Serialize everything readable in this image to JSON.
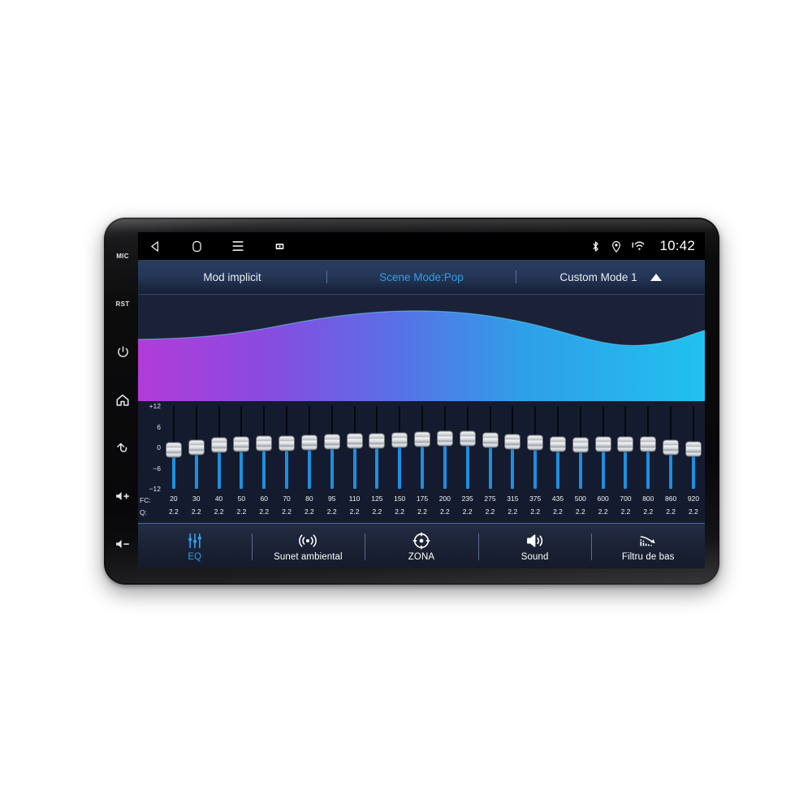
{
  "device": {
    "hard_keys": [
      {
        "name": "mic",
        "label": "MIC",
        "type": "text"
      },
      {
        "name": "reset",
        "label": "RST",
        "type": "text"
      },
      {
        "name": "power",
        "label": "",
        "type": "icon"
      },
      {
        "name": "home",
        "label": "",
        "type": "icon"
      },
      {
        "name": "back",
        "label": "",
        "type": "icon"
      },
      {
        "name": "volume-up",
        "label": "",
        "type": "icon"
      },
      {
        "name": "volume-down",
        "label": "",
        "type": "icon"
      }
    ]
  },
  "statusbar": {
    "nav_buttons": [
      "back-icon",
      "home-icon",
      "menu-icon",
      "screenshot-icon"
    ],
    "system_icons": [
      "bluetooth-icon",
      "location-icon",
      "wifi-icon"
    ],
    "clock": "10:42"
  },
  "modebar": {
    "items": [
      {
        "label": "Mod implicit",
        "active": false
      },
      {
        "label": "Scene Mode:Pop",
        "active": true
      },
      {
        "label": "Custom Mode 1",
        "active": false,
        "caret": true
      }
    ],
    "active_color": "#2f9fe8"
  },
  "curve": {
    "gradient_start": "#b23cd8",
    "gradient_end": "#21c1f0",
    "background": "#1b2237"
  },
  "equalizer": {
    "axis_labels": [
      "+12",
      "6",
      "0",
      "-6",
      "-12"
    ],
    "axis_values": [
      12,
      6,
      0,
      -6,
      -12
    ],
    "row_labels": {
      "fc": "FC:",
      "q": "Q:"
    },
    "track_color": "#1d8fe0",
    "bands": [
      {
        "fc": "20",
        "q": "2.2",
        "gain": -0.6
      },
      {
        "fc": "30",
        "q": "2.2",
        "gain": 0.0
      },
      {
        "fc": "40",
        "q": "2.2",
        "gain": 0.8
      },
      {
        "fc": "50",
        "q": "2.2",
        "gain": 1.0
      },
      {
        "fc": "60",
        "q": "2.2",
        "gain": 1.2
      },
      {
        "fc": "70",
        "q": "2.2",
        "gain": 1.2
      },
      {
        "fc": "80",
        "q": "2.2",
        "gain": 1.4
      },
      {
        "fc": "95",
        "q": "2.2",
        "gain": 1.6
      },
      {
        "fc": "110",
        "q": "2.2",
        "gain": 1.9
      },
      {
        "fc": "125",
        "q": "2.2",
        "gain": 2.0
      },
      {
        "fc": "150",
        "q": "2.2",
        "gain": 2.2
      },
      {
        "fc": "175",
        "q": "2.2",
        "gain": 2.3
      },
      {
        "fc": "200",
        "q": "2.2",
        "gain": 2.6
      },
      {
        "fc": "235",
        "q": "2.2",
        "gain": 2.6
      },
      {
        "fc": "275",
        "q": "2.2",
        "gain": 2.2
      },
      {
        "fc": "315",
        "q": "2.2",
        "gain": 1.6
      },
      {
        "fc": "375",
        "q": "2.2",
        "gain": 1.4
      },
      {
        "fc": "435",
        "q": "2.2",
        "gain": 1.0
      },
      {
        "fc": "500",
        "q": "2.2",
        "gain": 0.8
      },
      {
        "fc": "600",
        "q": "2.2",
        "gain": 0.9
      },
      {
        "fc": "700",
        "q": "2.2",
        "gain": 1.0
      },
      {
        "fc": "800",
        "q": "2.2",
        "gain": 0.9
      },
      {
        "fc": "860",
        "q": "2.2",
        "gain": 0.0
      },
      {
        "fc": "920",
        "q": "2.2",
        "gain": -0.5
      }
    ]
  },
  "tabbar": {
    "tabs": [
      {
        "label": "EQ",
        "icon": "equalizer-icon",
        "active": true
      },
      {
        "label": "Sunet ambiental",
        "icon": "surround-icon",
        "active": false
      },
      {
        "label": "ZONA",
        "icon": "zone-target-icon",
        "active": false
      },
      {
        "label": "Sound",
        "icon": "speaker-icon",
        "active": false
      },
      {
        "label": "Filtru de bas",
        "icon": "bass-filter-icon",
        "active": false
      }
    ]
  }
}
